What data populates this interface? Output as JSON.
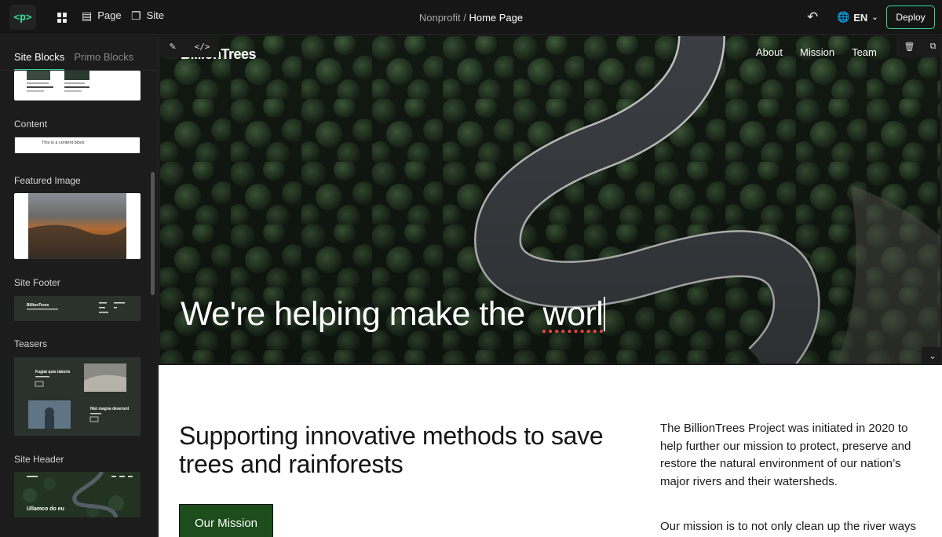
{
  "topbar": {
    "logo_glyph": "<p>",
    "page_label": "Page",
    "site_label": "Site",
    "breadcrumb_parent": "Nonprofit",
    "breadcrumb_sep": " / ",
    "breadcrumb_current": "Home Page",
    "language": "EN",
    "deploy_label": "Deploy"
  },
  "sidebar": {
    "tabs": [
      {
        "label": "Site Blocks",
        "active": true
      },
      {
        "label": "Primo Blocks",
        "active": false
      }
    ],
    "blocks": [
      {
        "label": "Content",
        "preview_text": "This is a content block"
      },
      {
        "label": "Featured Image"
      },
      {
        "label": "Site Footer",
        "preview_text": "BillionTrees"
      },
      {
        "label": "Teasers",
        "preview_titles": [
          "Fugiat quis laboris",
          "Nisi magna deserunt"
        ]
      },
      {
        "label": "Site Header",
        "preview_text": "Ullamco do eu"
      }
    ]
  },
  "site": {
    "logo": "BillionTrees",
    "nav": [
      "About",
      "Mission",
      "Team"
    ],
    "hero_heading": "We're helping make the  ",
    "hero_heading_typed": "worl",
    "section_heading": "Supporting innovative methods to save trees and rainforests",
    "cta_label": "Our Mission",
    "paragraphs": [
      "The BillionTrees Project was initiated in 2020 to help further our mission to protect, preserve and restore the natural environment of our nation’s major rivers and their watersheds.",
      "Our mission is to not only clean up the river ways"
    ]
  },
  "colors": {
    "accent": "#35d994",
    "cta_bg": "#1e4d1c",
    "hero_forest": "#1c2a1d"
  },
  "icons": [
    "grid-icon",
    "page-icon",
    "site-icon",
    "undo-icon",
    "globe-icon",
    "chevron-down-icon",
    "edit-icon",
    "code-icon",
    "trash-icon",
    "duplicate-icon"
  ]
}
